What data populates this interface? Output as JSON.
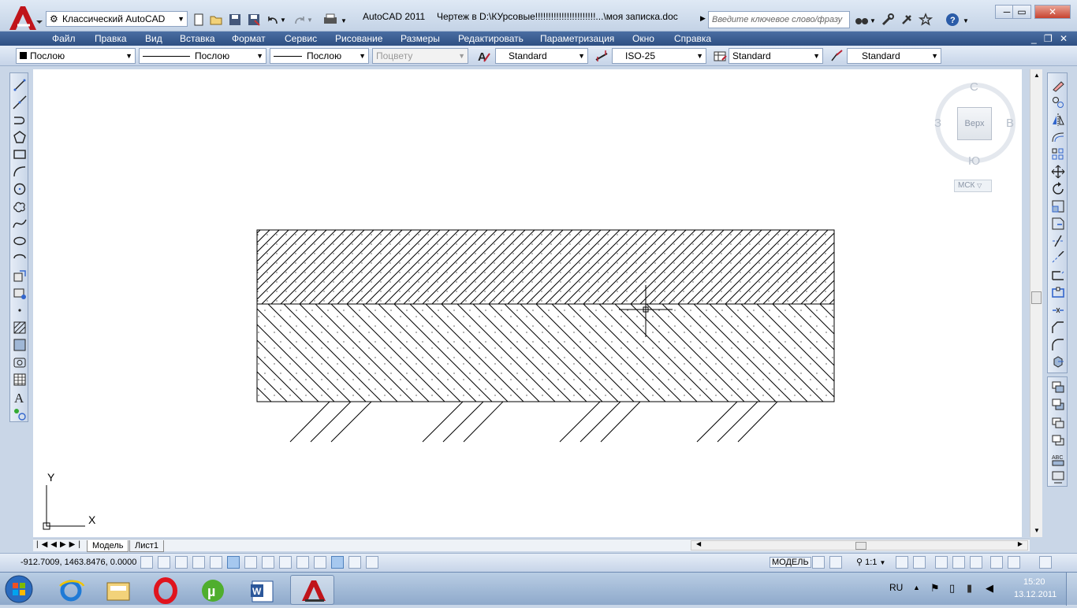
{
  "title_bar": {
    "workspace": "Классический AutoCAD",
    "app_title": "AutoCAD 2011",
    "file_title": "Чертеж в D:\\КУрсовые!!!!!!!!!!!!!!!!!!!!!!!...\\моя записка.doc",
    "search_placeholder": "Введите ключевое слово/фразу"
  },
  "menu": {
    "items": [
      "Файл",
      "Правка",
      "Вид",
      "Вставка",
      "Формат",
      "Сервис",
      "Рисование",
      "Размеры",
      "Редактировать",
      "Параметризация",
      "Окно",
      "Справка"
    ]
  },
  "properties": {
    "color": "Послою",
    "linetype": "Послою",
    "lineweight": "Послою",
    "plotstyle": "Поцвету",
    "text_style": "Standard",
    "dim_style": "ISO-25",
    "table_style": "Standard",
    "mleader_style": "Standard"
  },
  "viewcube": {
    "north": "С",
    "south": "Ю",
    "east": "В",
    "west": "З",
    "face": "Верх",
    "ucs": "МСК"
  },
  "ucs_icon": {
    "x": "X",
    "y": "Y"
  },
  "tabs": {
    "model": "Модель",
    "layout1": "Лист1"
  },
  "status": {
    "coords": "-912.7009, 1463.8476, 0.0000",
    "space": "МОДЕЛЬ",
    "scale": "1:1"
  },
  "taskbar": {
    "lang": "RU",
    "time": "15:20",
    "date": "13.12.2011"
  },
  "colors": {
    "menubar": "#2e4f82",
    "canvas": "#ffffff",
    "hatch": "#000000"
  }
}
